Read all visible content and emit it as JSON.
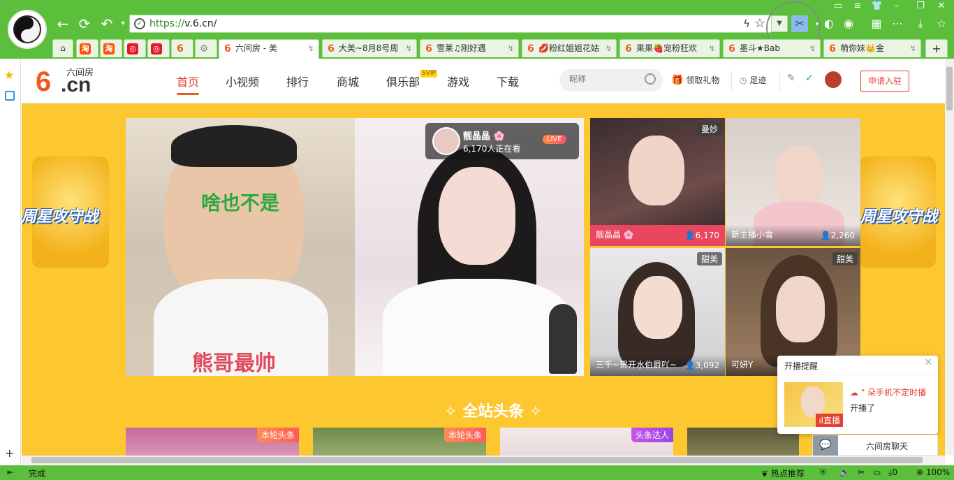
{
  "browser": {
    "url_protocol": "https://",
    "url_host": "v.6.cn/",
    "tabs": [
      {
        "label": "淘",
        "favicon": "taobao-icon",
        "fav_color": "#ff5000"
      },
      {
        "label": "淘",
        "favicon": "taobao-icon",
        "fav_color": "#ff5000"
      },
      {
        "label": "",
        "favicon": "weibo-icon",
        "fav_color": "#e6162d"
      },
      {
        "label": "",
        "favicon": "weibo-icon",
        "fav_color": "#e6162d"
      },
      {
        "label": "6",
        "favicon": "six-cn-icon",
        "fav_color": "#f05a22"
      },
      {
        "label": "",
        "favicon": "gear-icon",
        "fav_color": "#888888"
      },
      {
        "label": "六间房 - 美",
        "favicon": "six-cn-icon",
        "fav_color": "#f05a22"
      },
      {
        "label": "大美~8月8号周",
        "favicon": "six-cn-icon",
        "fav_color": "#f05a22"
      },
      {
        "label": "雪莱♫刚好遇",
        "favicon": "six-cn-icon",
        "fav_color": "#f05a22"
      },
      {
        "label": "💋粉红姐姐花姑",
        "favicon": "six-cn-icon",
        "fav_color": "#f05a22"
      },
      {
        "label": "果果🍓宠粉狂欢",
        "favicon": "six-cn-icon",
        "fav_color": "#f05a22"
      },
      {
        "label": "墨斗★Bab",
        "favicon": "six-cn-icon",
        "fav_color": "#f05a22"
      },
      {
        "label": "萌你妹👑金",
        "favicon": "six-cn-icon",
        "fav_color": "#f05a22"
      }
    ],
    "new_tab": "+",
    "status_left": "完成",
    "status_hot": "热点推荐",
    "status_count": "0",
    "status_zoom": "100%"
  },
  "site": {
    "logo_six": "6",
    "logo_cn": ".cn",
    "logo_name": "六间房",
    "nav": [
      "首页",
      "小视频",
      "排行",
      "商城",
      "俱乐部",
      "游戏",
      "下载"
    ],
    "svip": "SVIP",
    "search_placeholder": "昵称",
    "gift": "领取礼物",
    "footprint": "足迹",
    "apply": "申请入驻",
    "banner_text": "周星攻守战"
  },
  "player": {
    "overlay_top": "啥也不是",
    "overlay_bottom": "熊哥最帅",
    "live_name": "靓晶晶 🌸",
    "live_viewers": "6,170人正在看",
    "live_badge": "LIVE"
  },
  "thumbs": [
    {
      "tag": "曼妙",
      "name": "靓晶晶 🌸",
      "count": "6,170"
    },
    {
      "tag": "",
      "name": "新主播小雪",
      "count": "2,260"
    },
    {
      "tag": "甜美",
      "name": "三千~贺开水伯爵吖~",
      "count": "3,092"
    },
    {
      "tag": "甜美",
      "name": "可妍Y",
      "count": ""
    }
  ],
  "section_title": "全站头条",
  "cards": [
    {
      "label": "本轮头条"
    },
    {
      "label": "本轮头条"
    },
    {
      "label": "头条达人"
    },
    {
      "label": ""
    }
  ],
  "popup": {
    "title": "开播提醒",
    "name": "☁ \" 朵手机不定时播",
    "status": "开播了",
    "badge": "直播"
  },
  "chat": "六间房聊天"
}
